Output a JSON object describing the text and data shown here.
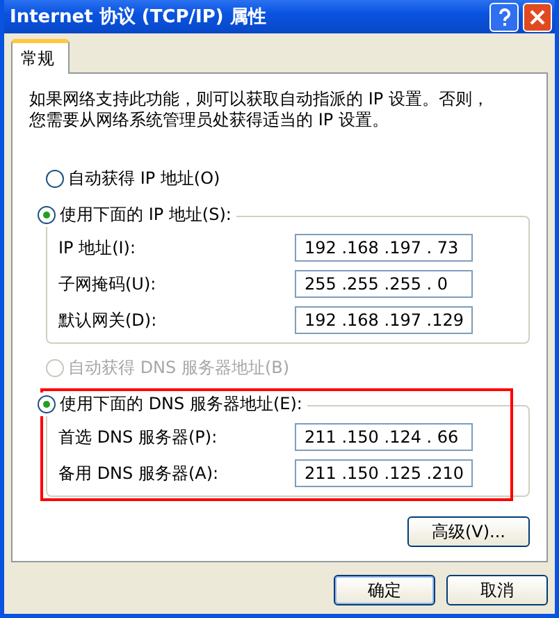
{
  "window": {
    "title": "Internet 协议 (TCP/IP) 属性"
  },
  "tabs": [
    {
      "label": "常规",
      "selected": true
    }
  ],
  "description": "如果网络支持此功能，则可以获取自动指派的 IP 设置。否则，您需要从网络系统管理员处获得适当的 IP 设置。",
  "ip_section": {
    "radios": [
      {
        "label": "自动获得 IP 地址(O)",
        "selected": false,
        "disabled": false
      },
      {
        "label": "使用下面的 IP 地址(S):",
        "selected": true,
        "disabled": false
      }
    ],
    "fields": [
      {
        "label": "IP 地址(I):",
        "value": "192 .168 .197 . 73"
      },
      {
        "label": "子网掩码(U):",
        "value": "255 .255 .255 . 0"
      },
      {
        "label": "默认网关(D):",
        "value": "192 .168 .197 .129"
      }
    ]
  },
  "dns_section": {
    "radios": [
      {
        "label": "自动获得 DNS 服务器地址(B)",
        "selected": false,
        "disabled": true
      },
      {
        "label": "使用下面的 DNS 服务器地址(E):",
        "selected": true,
        "disabled": false
      }
    ],
    "fields": [
      {
        "label": "首选 DNS 服务器(P):",
        "value": "211 .150 .124 . 66"
      },
      {
        "label": "备用 DNS 服务器(A):",
        "value": "211 .150 .125 .210"
      }
    ]
  },
  "advanced_button": "高级(V)...",
  "buttons": [
    {
      "label": "确定",
      "kind": "default"
    },
    {
      "label": "取消",
      "kind": "normal"
    }
  ]
}
